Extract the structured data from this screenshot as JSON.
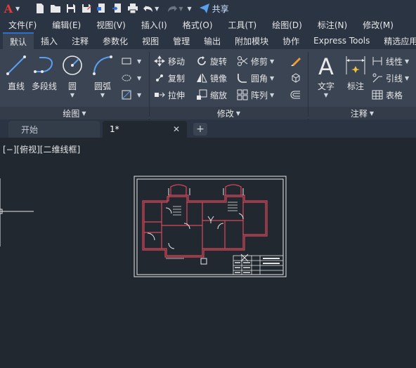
{
  "quick_access": {
    "app_letter": "A",
    "share_label": "共享"
  },
  "menu": [
    "文件(F)",
    "编辑(E)",
    "视图(V)",
    "插入(I)",
    "格式(O)",
    "工具(T)",
    "绘图(D)",
    "标注(N)",
    "修改(M)"
  ],
  "ribbon_tabs": [
    "默认",
    "插入",
    "注释",
    "参数化",
    "视图",
    "管理",
    "输出",
    "附加模块",
    "协作",
    "Express Tools",
    "精选应用"
  ],
  "ribbon": {
    "draw": {
      "title": "绘图",
      "line": "直线",
      "polyline": "多段线",
      "circle": "圆",
      "arc": "圆弧"
    },
    "modify": {
      "title": "修改",
      "move": "移动",
      "rotate": "旋转",
      "trim": "修剪",
      "copy": "复制",
      "mirror": "镜像",
      "fillet": "圆角",
      "stretch": "拉伸",
      "scale": "缩放",
      "array": "阵列"
    },
    "annotation": {
      "title": "注释",
      "text": "文字",
      "dimension": "标注",
      "linear": "线性",
      "leader": "引线",
      "table": "表格"
    }
  },
  "doc_tabs": {
    "start": "开始",
    "drawing": "1*",
    "add": "+"
  },
  "canvas": {
    "view_controls": "[−][俯视][二维线框]"
  },
  "colors": {
    "accent": "#2f6ecc",
    "background": "#212830",
    "ribbon": "#3b4453",
    "wall_red": "#d9485a"
  }
}
